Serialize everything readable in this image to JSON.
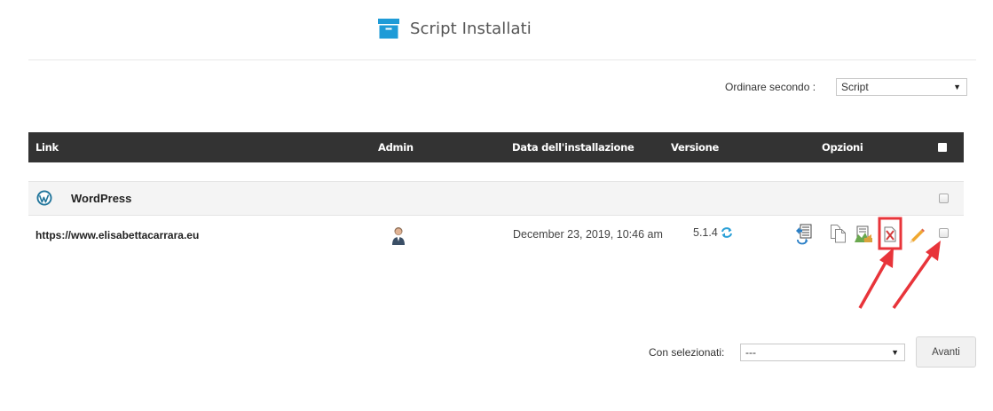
{
  "header": {
    "title": "Script Installati",
    "icon": "archive-box-icon",
    "icon_color": "#1e9bd7"
  },
  "sort": {
    "label": "Ordinare secondo :",
    "selected": "Script"
  },
  "table": {
    "columns": [
      "Link",
      "Admin",
      "Data dell'installazione",
      "Versione",
      "Opzioni"
    ],
    "header_bg": "#333333",
    "section": {
      "name": "WordPress",
      "icon": "wordpress-logo-icon"
    },
    "rows": [
      {
        "link": "https://www.elisabettacarrara.eu",
        "admin_icon": "admin-user-icon",
        "date": "December 23, 2019, 10:46 am",
        "version": "5.1.4",
        "version_icon": "update-refresh-icon",
        "options": [
          "backup-icon",
          "clone-icon",
          "staging-icon",
          "remove-icon",
          "edit-pencil-icon"
        ]
      }
    ]
  },
  "footer": {
    "label": "Con selezionati:",
    "selected": "---",
    "button_label": "Avanti"
  },
  "annotation_color": "#e8343a"
}
